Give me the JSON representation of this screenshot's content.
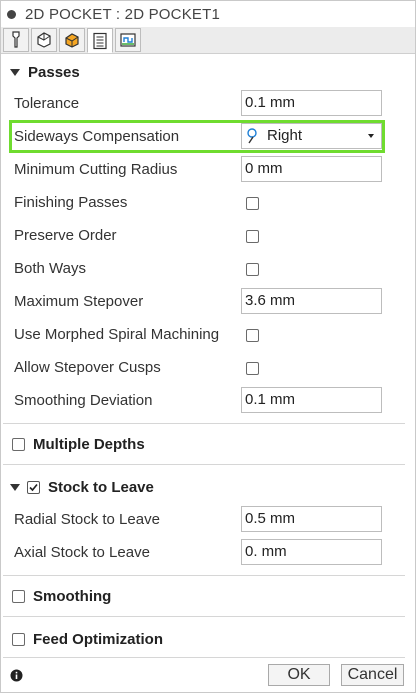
{
  "window": {
    "title": "2D POCKET : 2D POCKET1"
  },
  "tabs": [
    {
      "icon": "tool-icon"
    },
    {
      "icon": "geometry-icon"
    },
    {
      "icon": "heights-icon"
    },
    {
      "icon": "passes-icon"
    },
    {
      "icon": "linking-icon"
    }
  ],
  "passes": {
    "header": "Passes",
    "tolerance": {
      "label": "Tolerance",
      "value": "0.1 mm"
    },
    "sideways": {
      "label": "Sideways Compensation",
      "value": "Right"
    },
    "min_radius": {
      "label": "Minimum Cutting Radius",
      "value": "0 mm"
    },
    "finishing_passes": {
      "label": "Finishing Passes"
    },
    "preserve_order": {
      "label": "Preserve Order"
    },
    "both_ways": {
      "label": "Both Ways"
    },
    "max_stepover": {
      "label": "Maximum Stepover",
      "value": "3.6 mm"
    },
    "morphed_spiral": {
      "label": "Use Morphed Spiral Machining"
    },
    "stepover_cusps": {
      "label": "Allow Stepover Cusps"
    },
    "smoothing_deviation": {
      "label": "Smoothing Deviation",
      "value": "0.1 mm"
    }
  },
  "multiple_depths": {
    "header": "Multiple Depths"
  },
  "stock": {
    "header": "Stock to Leave",
    "radial": {
      "label": "Radial Stock to Leave",
      "value": "0.5 mm"
    },
    "axial": {
      "label": "Axial Stock to Leave",
      "value": "0. mm"
    }
  },
  "smoothing": {
    "header": "Smoothing"
  },
  "feed_optimization": {
    "header": "Feed Optimization"
  },
  "footer": {
    "ok_label": "OK",
    "cancel_label": "Cancel"
  },
  "colors": {
    "highlight": "#6fdc2f"
  }
}
